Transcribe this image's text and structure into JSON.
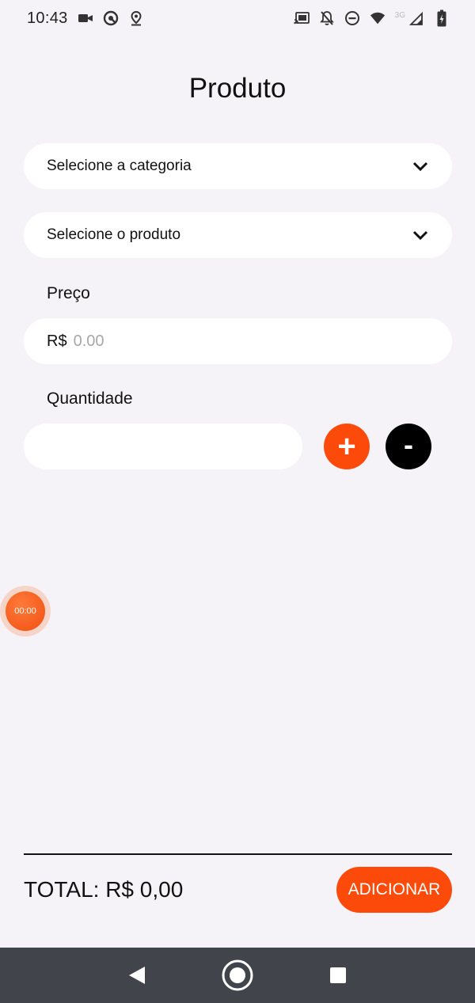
{
  "status_bar": {
    "time": "10:43",
    "network_label": "3G",
    "icons_left": [
      "video-camera-icon",
      "sync-icon",
      "location-icon"
    ],
    "icons_right": [
      "cast-icon",
      "notifications-off-icon",
      "do-not-disturb-icon",
      "wifi-icon",
      "signal-icon",
      "battery-charging-icon"
    ]
  },
  "page": {
    "title": "Produto"
  },
  "form": {
    "category_placeholder": "Selecione a categoria",
    "product_placeholder": "Selecione o produto",
    "price_label": "Preço",
    "currency": "R$",
    "price_placeholder": "0.00",
    "price_value": "",
    "quantity_label": "Quantidade",
    "quantity_value": "",
    "plus_label": "+",
    "minus_label": "-"
  },
  "recorder": {
    "elapsed": "00:00"
  },
  "footer": {
    "total_text": "TOTAL: R$ 0,00",
    "add_label": "ADICIONAR"
  },
  "colors": {
    "accent": "#fc4a0a",
    "background": "#f5f3f7",
    "nav_bar": "#41454b"
  }
}
